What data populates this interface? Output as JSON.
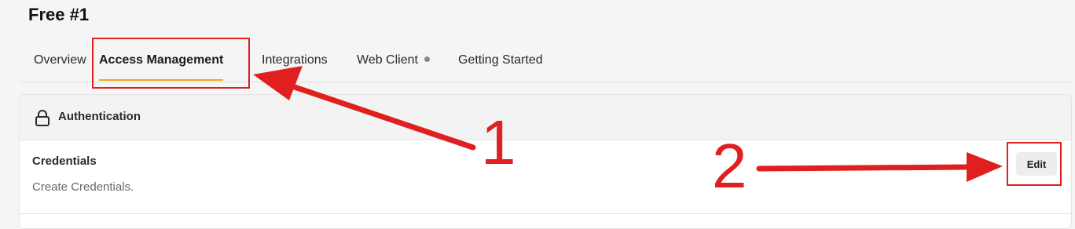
{
  "page": {
    "title": "Free #1"
  },
  "tabs": [
    {
      "label": "Overview"
    },
    {
      "label": "Access Management"
    },
    {
      "label": "Integrations"
    },
    {
      "label": "Web Client"
    },
    {
      "label": "Getting Started"
    }
  ],
  "auth_card": {
    "header": "Authentication",
    "icon": "lock-icon",
    "credentials": {
      "title": "Credentials",
      "description": "Create Credentials.",
      "edit_label": "Edit"
    }
  },
  "annotations": {
    "step1": "1",
    "step2": "2",
    "color": "#e02020"
  },
  "colors": {
    "accent": "#f5a623"
  }
}
